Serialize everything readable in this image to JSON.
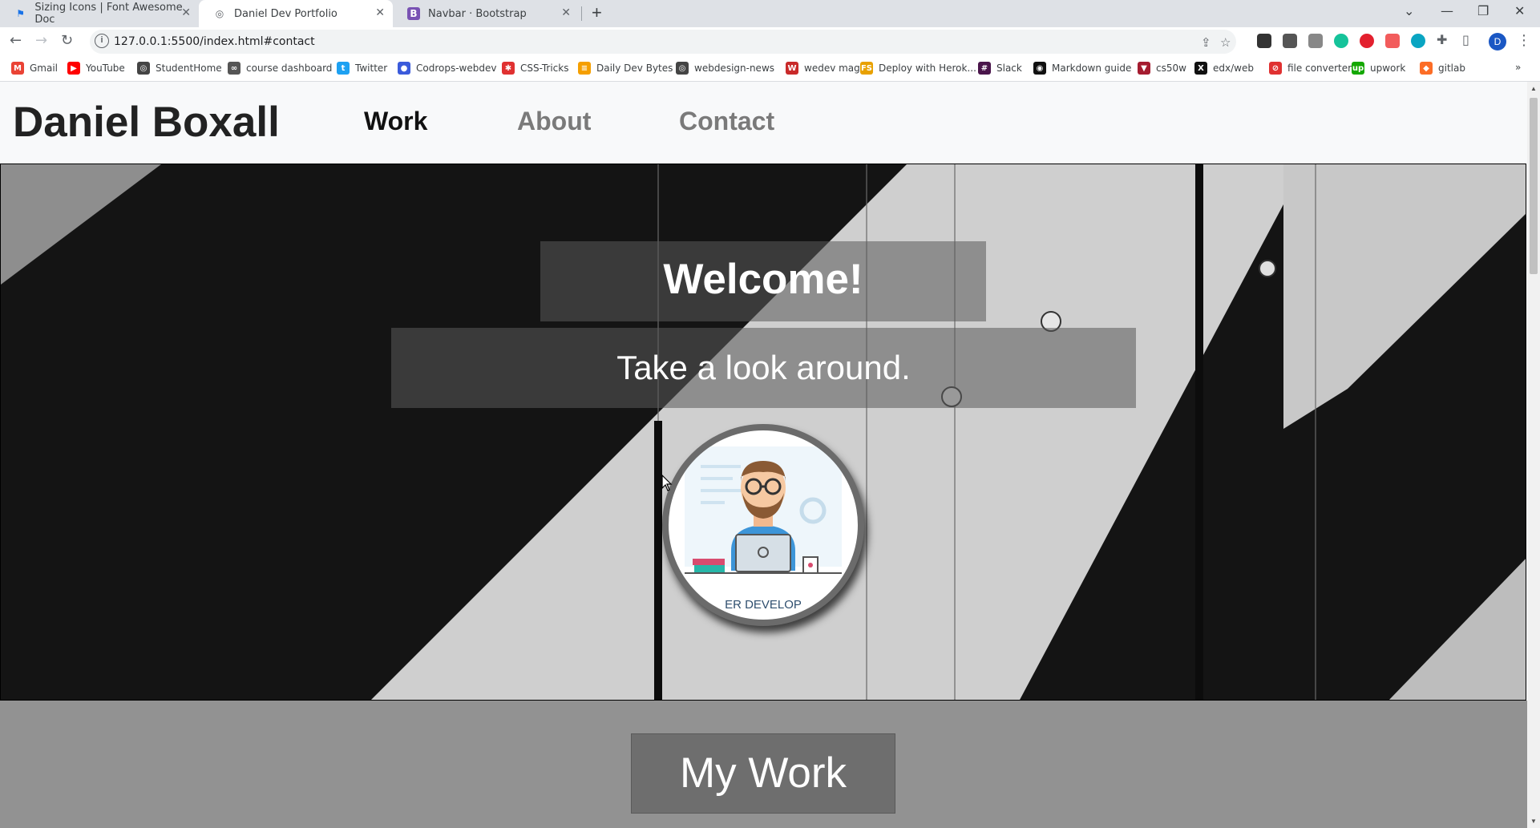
{
  "browser": {
    "tabs": [
      {
        "title": "Sizing Icons | Font Awesome Doc",
        "icon": "flag-icon",
        "active": false
      },
      {
        "title": "Daniel Dev Portfolio",
        "icon": "globe-icon",
        "active": true
      },
      {
        "title": "Navbar · Bootstrap",
        "icon": "bootstrap-icon",
        "active": false
      }
    ],
    "url": "127.0.0.1:5500/index.html#contact",
    "bookmarks": [
      {
        "label": "Gmail",
        "color": "#ea4335",
        "glyph": "M"
      },
      {
        "label": "YouTube",
        "color": "#ff0000",
        "glyph": "▶"
      },
      {
        "label": "StudentHome",
        "color": "#444444",
        "glyph": "◎"
      },
      {
        "label": "course dashboard",
        "color": "#555555",
        "glyph": "∞"
      },
      {
        "label": "Twitter",
        "color": "#1da1f2",
        "glyph": "t"
      },
      {
        "label": "Codrops-webdev",
        "color": "#3b5bdb",
        "glyph": "●"
      },
      {
        "label": "CSS-Tricks",
        "color": "#e03131",
        "glyph": "✱"
      },
      {
        "label": "Daily Dev Bytes",
        "color": "#f59f00",
        "glyph": "≡"
      },
      {
        "label": "webdesign-news",
        "color": "#444444",
        "glyph": "◎"
      },
      {
        "label": "wedev mag",
        "color": "#c92a2a",
        "glyph": "W"
      },
      {
        "label": "Deploy with Herok...",
        "color": "#e8a100",
        "glyph": "FS"
      },
      {
        "label": "Slack",
        "color": "#4a154b",
        "glyph": "#"
      },
      {
        "label": "Markdown guide",
        "color": "#111111",
        "glyph": "◉"
      },
      {
        "label": "cs50w",
        "color": "#a51c30",
        "glyph": "▼"
      },
      {
        "label": "edx/web",
        "color": "#111111",
        "glyph": "X"
      },
      {
        "label": "file converter",
        "color": "#e03131",
        "glyph": "⊘"
      },
      {
        "label": "upwork",
        "color": "#14a800",
        "glyph": "up"
      },
      {
        "label": "gitlab",
        "color": "#fc6d26",
        "glyph": "◆"
      }
    ],
    "profile_initial": "D"
  },
  "site": {
    "brand": "Daniel Boxall",
    "nav": [
      {
        "label": "Work",
        "color": "#111111"
      },
      {
        "label": "About",
        "color": "#7a7a7a"
      },
      {
        "label": "Contact",
        "color": "#7a7a7a"
      }
    ],
    "hero": {
      "title": "Welcome!",
      "subtitle": "Take a look around.",
      "avatar_caption": "ER DEVELOP"
    },
    "work": {
      "button_label": "My Work"
    }
  }
}
